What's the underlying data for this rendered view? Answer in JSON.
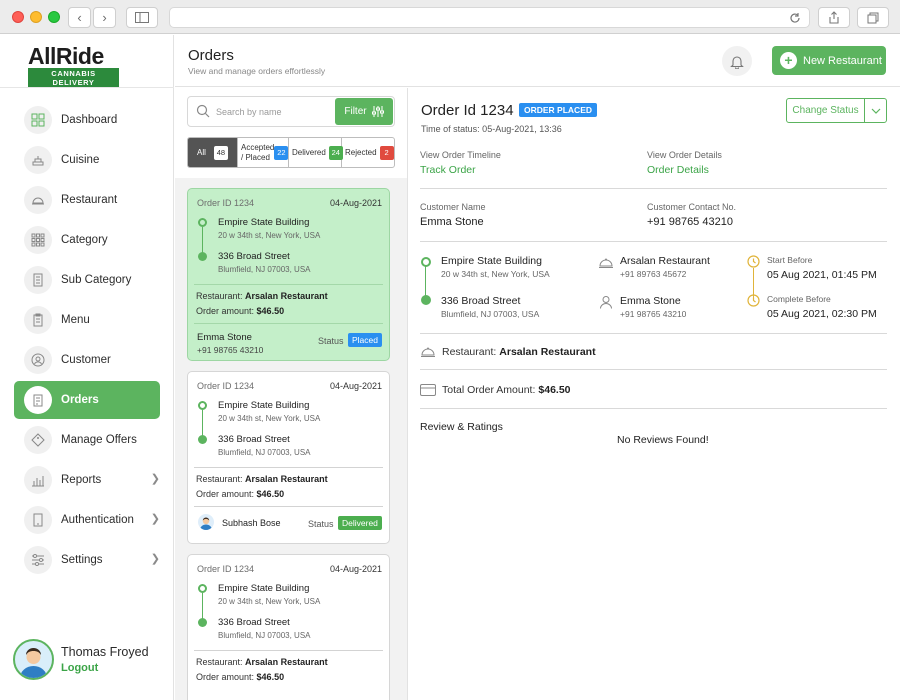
{
  "brand": {
    "name": "AllRide",
    "tagline": "CANNABIS DELIVERY",
    "accent": "#5cb45f"
  },
  "sidebar": {
    "items": [
      {
        "label": "Dashboard",
        "icon": "dashboard-grid-icon"
      },
      {
        "label": "Cuisine",
        "icon": "cuisine-icon"
      },
      {
        "label": "Restaurant",
        "icon": "restaurant-icon"
      },
      {
        "label": "Category",
        "icon": "category-icon"
      },
      {
        "label": "Sub Category",
        "icon": "sub-category-icon"
      },
      {
        "label": "Menu",
        "icon": "menu-icon"
      },
      {
        "label": "Customer",
        "icon": "customer-icon"
      },
      {
        "label": "Orders",
        "icon": "orders-icon",
        "active": true
      },
      {
        "label": "Manage Offers",
        "icon": "offers-icon"
      },
      {
        "label": "Reports",
        "icon": "reports-icon",
        "has_submenu": true
      },
      {
        "label": "Authentication",
        "icon": "authentication-icon",
        "has_submenu": true
      },
      {
        "label": "Settings",
        "icon": "settings-icon",
        "has_submenu": true
      }
    ],
    "user": {
      "name": "Thomas Froyed",
      "logout_label": "Logout"
    }
  },
  "header": {
    "title": "Orders",
    "subtitle": "View and manage orders effortlessly",
    "new_button_label": "New Restaurant"
  },
  "orders_list": {
    "search_placeholder": "Search by name",
    "filter_label": "Filter",
    "tabs": [
      {
        "label": "All",
        "count": "48",
        "active": true
      },
      {
        "label": "Accepted / Placed",
        "count": "22"
      },
      {
        "label": "Delivered",
        "count": "24"
      },
      {
        "label": "Rejected",
        "count": "2"
      }
    ],
    "cards": [
      {
        "order_id": "Order ID 1234",
        "date": "04-Aug-2021",
        "pickup_name": "Empire State Building",
        "pickup_address": "20 w 34th st, New York, USA",
        "drop_name": "336 Broad Street",
        "drop_address": "Blumfield, NJ 07003, USA",
        "restaurant_label": "Restaurant:",
        "restaurant": "Arsalan Restaurant",
        "amount_label": "Order amount:",
        "amount": "$46.50",
        "customer_name": "Emma Stone",
        "customer_phone": "+91 98765 43210",
        "status_label": "Status",
        "status": "Placed",
        "selected": true
      },
      {
        "order_id": "Order ID 1234",
        "date": "04-Aug-2021",
        "pickup_name": "Empire State Building",
        "pickup_address": "20 w 34th st, New York, USA",
        "drop_name": "336 Broad Street",
        "drop_address": "Blumfield, NJ 07003, USA",
        "restaurant_label": "Restaurant:",
        "restaurant": "Arsalan Restaurant",
        "amount_label": "Order amount:",
        "amount": "$46.50",
        "customer_name": "Subhash Bose",
        "status_label": "Status",
        "status": "Delivered"
      },
      {
        "order_id": "Order ID 1234",
        "date": "04-Aug-2021",
        "pickup_name": "Empire State Building",
        "pickup_address": "20 w 34th st, New York, USA",
        "drop_name": "336 Broad Street",
        "drop_address": "Blumfield, NJ 07003, USA",
        "restaurant_label": "Restaurant:",
        "restaurant": "Arsalan Restaurant",
        "amount_label": "Order amount:",
        "amount": "$46.50"
      }
    ]
  },
  "detail": {
    "title": "Order Id 1234",
    "status_badge": "ORDER PLACED",
    "time_of_status": "Time of status: 05-Aug-2021, 13:36",
    "change_status_label": "Change Status",
    "timeline_label": "View Order Timeline",
    "timeline_link": "Track Order",
    "details_label": "View Order Details",
    "details_link": "Order Details",
    "customer_name_label": "Customer Name",
    "customer_name": "Emma Stone",
    "customer_contact_label": "Customer Contact No.",
    "customer_contact": "+91 98765 43210",
    "route": {
      "pickup_name": "Empire State Building",
      "pickup_address": "20 w 34th st, New York, USA",
      "drop_name": "336 Broad Street",
      "drop_address": "Blumfield, NJ 07003, USA",
      "restaurant_name": "Arsalan Restaurant",
      "restaurant_phone": "+91 89763 45672",
      "customer_name": "Emma Stone",
      "customer_phone": "+91 98765 43210",
      "start_before_label": "Start Before",
      "start_before": "05 Aug 2021, 01:45 PM",
      "complete_before_label": "Complete Before",
      "complete_before": "05 Aug 2021, 02:30 PM"
    },
    "restaurant_label": "Restaurant:",
    "restaurant": "Arsalan Restaurant",
    "total_label": "Total Order Amount:",
    "total": "$46.50",
    "reviews_title": "Review & Ratings",
    "no_reviews": "No Reviews Found!"
  }
}
